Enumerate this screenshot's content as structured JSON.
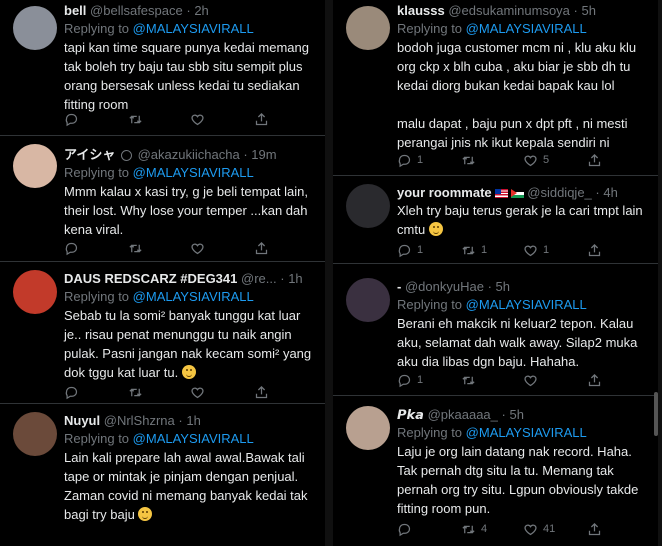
{
  "left_tweets": [
    {
      "avatar": {
        "icon": "avatar-photo",
        "bg": "#8a8f99"
      },
      "name": "bell",
      "handle": "@bellsafespace",
      "sep": "·",
      "time": "2h",
      "reply_prefix": "Replying to",
      "mention": "@MALAYSIAVIRALL",
      "text": "tapi kan time square punya kedai memang\ntak boleh try baju tau sbb situ sempit plus\norang bersesak unless kedai tu sediakan\nfitting room",
      "counts": {
        "reply": "",
        "retweet": "",
        "like": ""
      }
    },
    {
      "avatar": {
        "icon": "avatar-photo",
        "bg": "#d8b7a4"
      },
      "name": "アイシャ",
      "badge": "verified-icon",
      "handle": "@akazukiichacha",
      "sep": "·",
      "time": "19m",
      "reply_prefix": "Replying to",
      "mention": "@MALAYSIAVIRALL",
      "text": "Mmm kalau x kasi try, g je beli tempat lain,\ntheir lost. Why lose your temper ...kan dah\nkena viral.",
      "counts": {
        "reply": "",
        "retweet": "",
        "like": ""
      }
    },
    {
      "avatar": {
        "icon": "avatar-photo",
        "bg": "#c23a2a"
      },
      "name": "DAUS REDSCARZ #DEG341",
      "handle": "@re...",
      "sep": "·",
      "time": "1h",
      "reply_prefix": "Replying to",
      "mention": "@MALAYSIAVIRALL",
      "text": "Sebab tu la somi² banyak tunggu kat luar\nje.. risau penat menunggu tu naik angin\npulak. Pasni jangan nak kecam somi² yang\ndok tggu kat luar tu.",
      "emoji": "grinning-emoji",
      "counts": {
        "reply": "",
        "retweet": "",
        "like": ""
      }
    },
    {
      "avatar": {
        "icon": "avatar-photo",
        "bg": "#6b4a3a"
      },
      "name": "Nuyul",
      "handle": "@NrlShzrna",
      "sep": "·",
      "time": "1h",
      "reply_prefix": "Replying to",
      "mention": "@MALAYSIAVIRALL",
      "text": "Lain kali prepare lah awal awal.Bawak tali\ntape or mintak je pinjam dengan penjual.\nZaman covid ni memang banyak kedai tak\nbagi try baju",
      "emoji": "sweat-smile-emoji",
      "counts": {
        "reply": "",
        "retweet": "",
        "like": ""
      }
    }
  ],
  "right_tweets": [
    {
      "avatar": {
        "icon": "avatar-photo",
        "bg": "#9a8a7a"
      },
      "name": "klausss",
      "handle": "@edsukaminumsoya",
      "sep": "·",
      "time": "5h",
      "reply_prefix": "Replying to",
      "mention": "@MALAYSIAVIRALL",
      "text": "bodoh juga customer mcm ni , klu aku klu\norg ckp x blh cuba , aku biar je sbb dh tu\nkedai diorg bukan kedai bapak kau lol\n\nmalu dapat , baju pun x dpt pft , ni mesti\nperangai jnis nk ikut kepala sendiri ni",
      "counts": {
        "reply": "1",
        "retweet": "",
        "like": "5"
      }
    },
    {
      "avatar": {
        "icon": "avatar-photo",
        "bg": "#2a2a2e"
      },
      "name": "your roommate",
      "flags": [
        "malaysia-flag",
        "palestine-flag"
      ],
      "handle": "@siddiqje_",
      "sep": "·",
      "time": "4h",
      "reply_prefix": "",
      "mention": "",
      "text": "Xleh try baju terus gerak je la cari tmpt lain\ncmtu",
      "emoji": "smiling-emoji",
      "counts": {
        "reply": "1",
        "retweet": "1",
        "like": "1"
      }
    },
    {
      "avatar": {
        "icon": "avatar-photo",
        "bg": "#3a3040"
      },
      "name": "-",
      "handle": "@donkyuHae",
      "sep": "·",
      "time": "5h",
      "reply_prefix": "Replying to",
      "mention": "@MALAYSIAVIRALL",
      "text": "Berani eh makcik ni keluar2 tepon. Kalau\naku, selamat dah walk away. Silap2 muka\naku dia libas dgn baju. Hahaha.",
      "counts": {
        "reply": "1",
        "retweet": "",
        "like": ""
      }
    },
    {
      "avatar": {
        "icon": "avatar-photo",
        "bg": "#b8a090"
      },
      "name": "𝙋𝙠𝙖",
      "handle": "@pkaaaaa_",
      "sep": "·",
      "time": "5h",
      "reply_prefix": "Replying to",
      "mention": "@MALAYSIAVIRALL",
      "text": "Laju je org lain datang nak record. Haha.\nTak pernah dtg situ la tu. Memang tak\npernah org try situ. Lgpun obviously takde\nfitting room pun.",
      "counts": {
        "reply": "",
        "retweet": "4",
        "like": "41"
      }
    }
  ]
}
